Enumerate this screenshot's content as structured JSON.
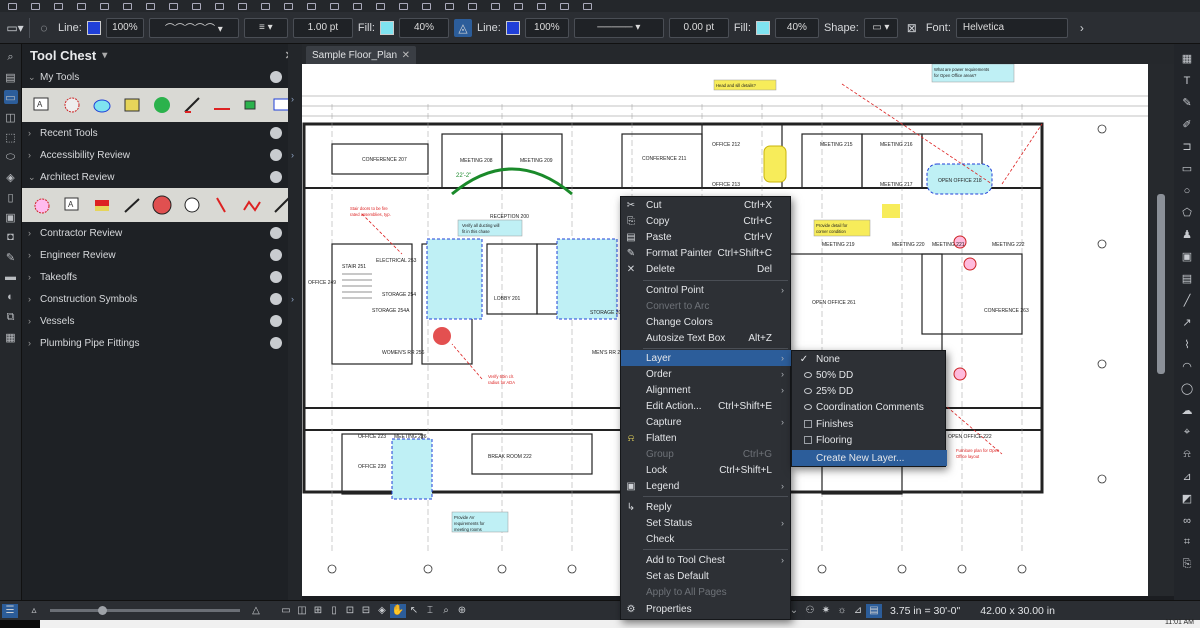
{
  "toolbar": {
    "line_label": "Line:",
    "line_opacity": "100%",
    "line_width": "1.00 pt",
    "fill_label": "Fill:",
    "fill_opacity": "40%",
    "line2_label": "Line:",
    "line2_opacity": "100%",
    "line2_width": "0.00 pt",
    "fill2_label": "Fill:",
    "fill2_opacity": "40%",
    "shape_label": "Shape:",
    "font_label": "Font:",
    "font_value": "Helvetica",
    "line_color": "#1f3fd8",
    "fill_color": "#7fe3f0"
  },
  "panel": {
    "title": "Tool Chest",
    "sections": [
      {
        "label": "My Tools"
      },
      {
        "label": "Recent Tools"
      },
      {
        "label": "Accessibility Review"
      },
      {
        "label": "Architect Review"
      },
      {
        "label": "Contractor Review"
      },
      {
        "label": "Engineer Review"
      },
      {
        "label": "Takeoffs"
      },
      {
        "label": "Construction Symbols"
      },
      {
        "label": "Vessels"
      },
      {
        "label": "Plumbing Pipe Fittings"
      }
    ]
  },
  "document": {
    "tab_label": "Sample Floor_Plan"
  },
  "drawing": {
    "rooms": [
      "CONFERENCE 207",
      "MEETING 208",
      "MEETING 209",
      "CONFERENCE 211",
      "OFFICE 212",
      "OFFICE 213",
      "MEETING 215",
      "MEETING 216",
      "MEETING 217",
      "OPEN OFFICE 218",
      "RECEPTION 200",
      "LOBBY 201",
      "STORAGE 202",
      "ELECTRICAL 253",
      "STORAGE 254",
      "STORAGE 254A",
      "STAIR 251",
      "WOMEN'S RR 256",
      "MEN'S RR 257",
      "OPEN OFFICE 261",
      "CONFERENCE 263",
      "MEETING 219",
      "MEETING 220",
      "MEETING 221",
      "MEETING 222",
      "OFFICE 223",
      "OFFICE 224",
      "OFFICE 225",
      "MEETING 226",
      "BREAK ROOM 222",
      "OPEN OFFICE 222",
      "MEETING 230",
      "OFFICE 249",
      "OFFICE 239"
    ],
    "callouts": [
      "Head and sill details?",
      "What are power requirements for Open Office areas?",
      "Provide detail for corner condition",
      "Stair doors to be fire rated assemblies, typ.",
      "Verify all ducting will fit in this chase",
      "Verify 60in clr. radius for ADA",
      "Provide AV requirements for meeting rooms",
      "Furniture plan for Open Office layout"
    ],
    "curve_label": "22'-2\""
  },
  "context_menu": {
    "items": [
      {
        "label": "Cut",
        "shortcut": "Ctrl+X",
        "icon": "scissors-icon"
      },
      {
        "label": "Copy",
        "shortcut": "Ctrl+C",
        "icon": "copy-icon"
      },
      {
        "label": "Paste",
        "shortcut": "Ctrl+V",
        "icon": "paste-icon"
      },
      {
        "label": "Format Painter",
        "shortcut": "Ctrl+Shift+C",
        "icon": "format-painter-icon"
      },
      {
        "label": "Delete",
        "shortcut": "Del",
        "icon": "delete-icon"
      },
      {
        "label": "Control Point",
        "submenu": true
      },
      {
        "label": "Convert to Arc",
        "disabled": true
      },
      {
        "label": "Change Colors"
      },
      {
        "label": "Autosize Text Box",
        "shortcut": "Alt+Z"
      },
      {
        "label": "Layer",
        "submenu": true,
        "highlighted": true
      },
      {
        "label": "Order",
        "submenu": true
      },
      {
        "label": "Alignment",
        "submenu": true
      },
      {
        "label": "Edit Action...",
        "shortcut": "Ctrl+Shift+E"
      },
      {
        "label": "Capture",
        "submenu": true
      },
      {
        "label": "Flatten",
        "icon": "flatten-icon"
      },
      {
        "label": "Group",
        "shortcut": "Ctrl+G",
        "disabled": true
      },
      {
        "label": "Lock",
        "shortcut": "Ctrl+Shift+L"
      },
      {
        "label": "Legend",
        "submenu": true,
        "icon": "legend-icon"
      },
      {
        "label": "Reply",
        "icon": "reply-icon"
      },
      {
        "label": "Set Status",
        "submenu": true
      },
      {
        "label": "Check"
      },
      {
        "label": "Add to Tool Chest",
        "submenu": true
      },
      {
        "label": "Set as Default"
      },
      {
        "label": "Apply to All Pages",
        "disabled": true
      },
      {
        "label": "Properties",
        "icon": "properties-icon"
      }
    ]
  },
  "layer_submenu": {
    "items": [
      {
        "label": "None",
        "checked": true
      },
      {
        "label": "50% DD",
        "visible": true
      },
      {
        "label": "25% DD",
        "visible": true
      },
      {
        "label": "Coordination Comments",
        "visible": true
      },
      {
        "label": "Finishes",
        "checkbox": true
      },
      {
        "label": "Flooring",
        "checkbox": true
      },
      {
        "label": "Create New Layer...",
        "highlighted": true
      }
    ]
  },
  "status": {
    "scale": "3.75 in = 30'-0\"",
    "page_size": "42.00 x 30.00 in",
    "clock": "11:01 AM"
  }
}
